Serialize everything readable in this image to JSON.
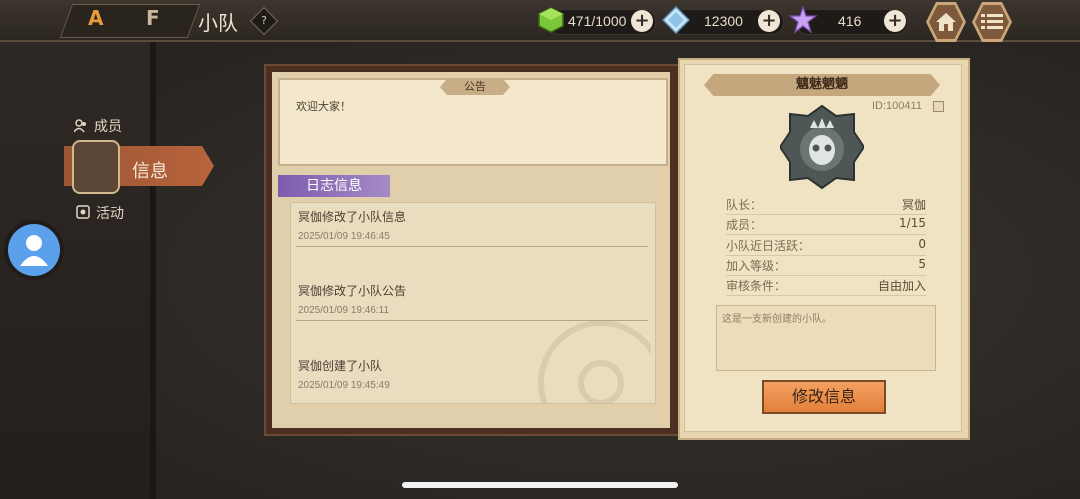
{
  "header": {
    "title": "小队",
    "help_symbol": "?",
    "logo_text_a": "A",
    "logo_text_b": "F",
    "resources": [
      {
        "icon": "green-cube-icon",
        "value": "471/1000",
        "plus": "+"
      },
      {
        "icon": "blue-crystal-icon",
        "value": "12300",
        "plus": "+"
      },
      {
        "icon": "purple-crystal-icon",
        "value": "416",
        "plus": "+"
      }
    ]
  },
  "nav": {
    "members_label": "成员",
    "info_label": "信息",
    "activity_label": "活动"
  },
  "notice": {
    "tag": "公告",
    "text": "欢迎大家！"
  },
  "log": {
    "tag": "日志信息",
    "entries": [
      {
        "title": "冥伽修改了小队信息",
        "time": "2025/01/09 19:46:45"
      },
      {
        "title": "冥伽修改了小队公告",
        "time": "2025/01/09 19:46:11"
      },
      {
        "title": "冥伽创建了小队",
        "time": "2025/01/09 19:45:49"
      }
    ]
  },
  "team": {
    "name": "魑魅魍魉",
    "id": "ID:100411",
    "rows": [
      {
        "label": "队长：",
        "value": "冥伽"
      },
      {
        "label": "成员：",
        "value": "1/15"
      },
      {
        "label": "小队近日活跃：",
        "value": "0"
      },
      {
        "label": "加入等级：",
        "value": "5"
      },
      {
        "label": "审核条件：",
        "value": "自由加入"
      }
    ],
    "description": "这是一支新创建的小队。",
    "edit_button": "修改信息"
  },
  "colors": {
    "accent_orange": "#e8893f",
    "log_tag_purple": "#8b6db8",
    "paper": "#f0e3c3"
  }
}
